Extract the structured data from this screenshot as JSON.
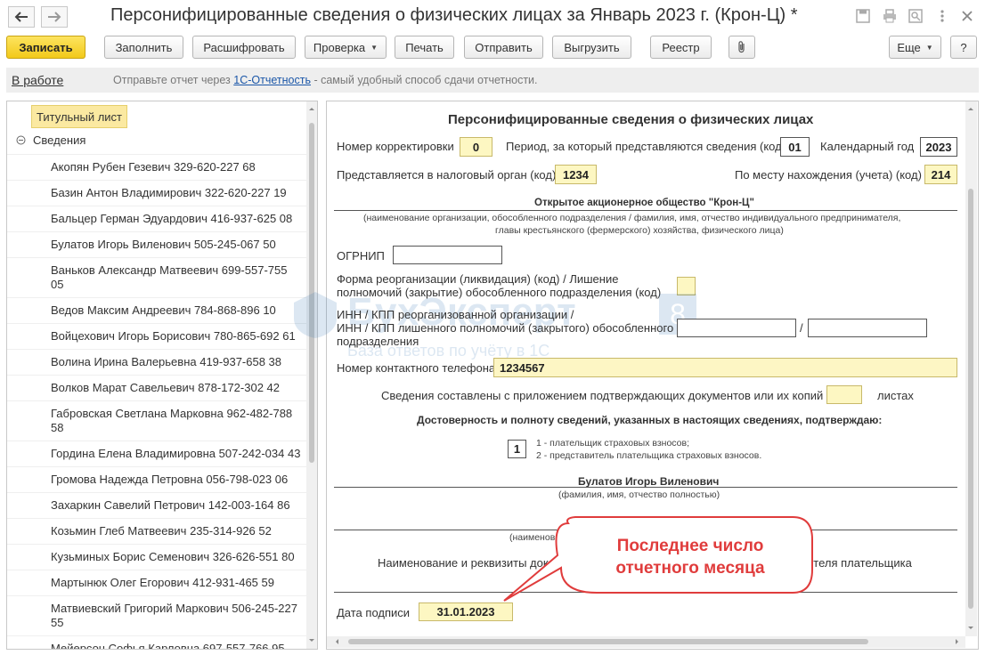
{
  "window": {
    "title": "Персонифицированные сведения о физических лицах за Январь 2023 г. (Крон-Ц) *"
  },
  "toolbar": {
    "save": "Записать",
    "fill": "Заполнить",
    "decode": "Расшифровать",
    "check": "Проверка",
    "print": "Печать",
    "send": "Отправить",
    "export": "Выгрузить",
    "registry": "Реестр",
    "more": "Еще",
    "help": "?"
  },
  "status": {
    "label": "В работе",
    "info_prefix": "Отправьте отчет через ",
    "info_link": "1С-Отчетность",
    "info_suffix": " - самый удобный способ сдачи отчетности."
  },
  "tree": {
    "title_page": "Титульный лист",
    "group": "Сведения",
    "items": [
      {
        "label": "Акопян Рубен Гезевич 329-620-227 68"
      },
      {
        "label": "Базин Антон Владимирович 322-620-227 19"
      },
      {
        "label": "Бальцер Герман Эдуардович 416-937-625 08"
      },
      {
        "label": "Булатов Игорь Виленович 505-245-067 50"
      },
      {
        "label": "Ваньков Александр Матвеевич 699-557-755 05"
      },
      {
        "label": "Ведов Максим Андреевич 784-868-896 10"
      },
      {
        "label": "Войцехович Игорь Борисович 780-865-692 61"
      },
      {
        "label": "Волина Ирина Валерьевна 419-937-658 38"
      },
      {
        "label": "Волков Марат Савельевич 878-172-302 42"
      },
      {
        "label": "Габровская Светлана Марковна 962-482-788 58"
      },
      {
        "label": "Гордина Елена Владимировна 507-242-034 43"
      },
      {
        "label": "Громова Надежда Петровна 056-798-023 06"
      },
      {
        "label": "Захаркин Савелий Петрович 142-003-164 86"
      },
      {
        "label": "Козьмин Глеб Матвеевич 235-314-926 52"
      },
      {
        "label": "Кузьминых Борис Семенович 326-626-551 80"
      },
      {
        "label": "Мартынюк Олег Егорович 412-931-465 59"
      },
      {
        "label": "Матвиевский Григорий Маркович 506-245-227 55"
      },
      {
        "label": "Мейерсон Софья Карловна 697-557-766 95"
      }
    ]
  },
  "form": {
    "heading": "Персонифицированные сведения о физических лицах",
    "correction_label": "Номер корректировки",
    "correction_value": "0",
    "period_label": "Период, за который представляются сведения (код)",
    "period_value": "01",
    "year_label": "Календарный год",
    "year_value": "2023",
    "tax_authority_label": "Представляется в налоговый орган (код)",
    "tax_authority_value": "1234",
    "location_label": "По месту нахождения (учета) (код)",
    "location_value": "214",
    "org_name": "Открытое акционерное общество \"Крон-Ц\"",
    "org_hint_1": "(наименование организации, обособленного подразделения / фамилия, имя, отчество индивидуального предпринимателя,",
    "org_hint_2": "главы крестьянского (фермерского) хозяйства, физического лица)",
    "ogrnip_label": "ОГРНИП",
    "reorg_label_1": "Форма реорганизации (ликвидация) (код) / Лишение",
    "reorg_label_2": "полномочий (закрытие) обособленного подразделения (код)",
    "inn_label_1": "ИНН / КПП реорганизованной организации /",
    "inn_label_2": "ИНН / КПП лишенного полномочий (закрытого) обособленного",
    "inn_label_3": "подразделения",
    "inn_separator": "/",
    "phone_label": "Номер контактного телефона",
    "phone_value": "1234567",
    "docs_label": "Сведения составлены с приложением подтверждающих документов или их копий на",
    "docs_suffix": "листах",
    "confirm_heading": "Достоверность и полноту сведений, указанных в настоящих сведениях, подтверждаю:",
    "confirm_value": "1",
    "confirm_opt_1": "1 - плательщик страховых взносов;",
    "confirm_opt_2": "2 - представитель плательщика страховых взносов.",
    "signer_name": "Булатов Игорь Виленович",
    "signer_hint": "(фамилия, имя, отчество полностью)",
    "rep_hint": "(наименов",
    "doc_req_left": "Наименование и реквизиты док",
    "doc_req_right": "ителя плательщика",
    "sign_date_label": "Дата подписи",
    "sign_date_value": "31.01.2023"
  },
  "watermark": {
    "brand": "БухЭксперт",
    "badge": "8",
    "tagline": "База ответов по учёту в 1С"
  },
  "callout": {
    "line1": "Последнее число",
    "line2": "отчетного месяца",
    "color": "#e03c3c"
  }
}
